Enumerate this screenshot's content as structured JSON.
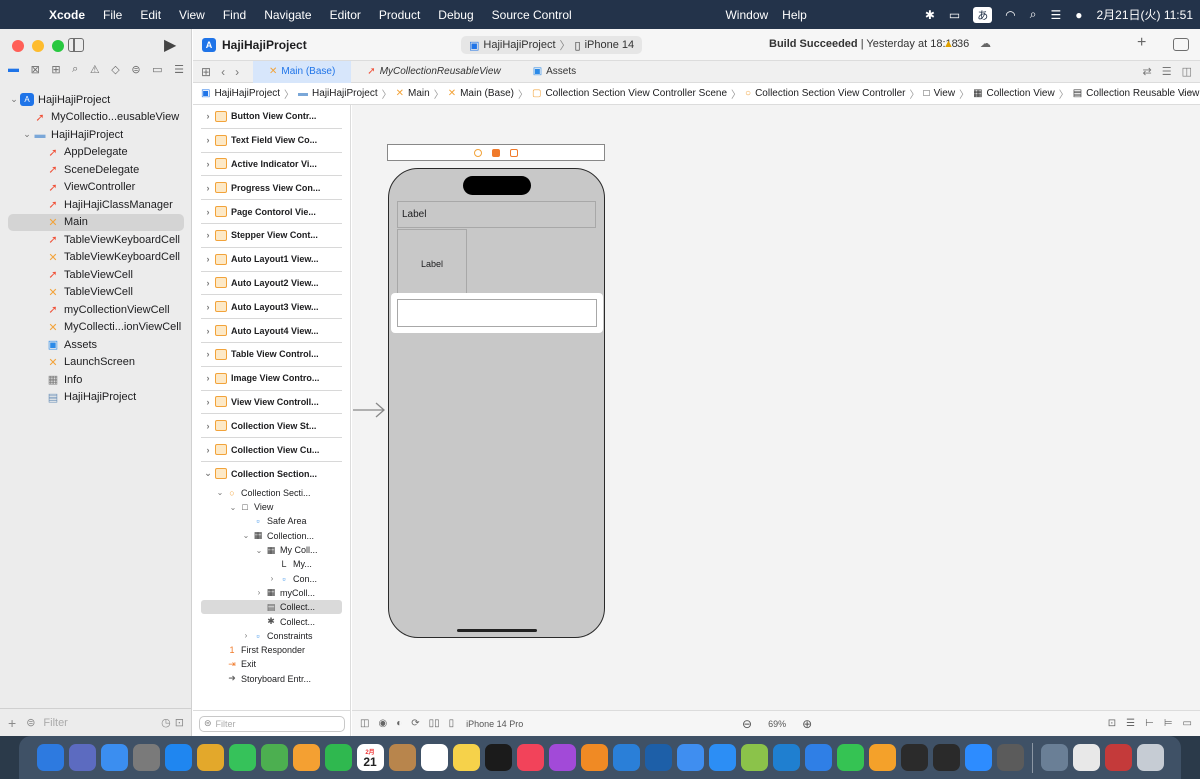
{
  "menubar": {
    "app": "Xcode",
    "items": [
      "File",
      "Edit",
      "View",
      "Find",
      "Navigate",
      "Editor",
      "Product",
      "Debug",
      "Source Control"
    ],
    "right_items": [
      "Window",
      "Help"
    ],
    "input_method": "あ",
    "clock": "2月21日(火)  11:51"
  },
  "navigator": {
    "tree": [
      {
        "label": "HajiHajiProject",
        "icon": "app-icon",
        "chev": "⌄",
        "indent": 0
      },
      {
        "label": "MyCollectio...eusableView",
        "icon": "swift-icon",
        "chev": "",
        "indent": 1
      },
      {
        "label": "HajiHajiProject",
        "icon": "folder-icon",
        "chev": "⌄",
        "indent": 1
      },
      {
        "label": "AppDelegate",
        "icon": "swift-icon",
        "chev": "",
        "indent": 2
      },
      {
        "label": "SceneDelegate",
        "icon": "swift-icon",
        "chev": "",
        "indent": 2
      },
      {
        "label": "ViewController",
        "icon": "swift-icon",
        "chev": "",
        "indent": 2
      },
      {
        "label": "HajiHajiClassManager",
        "icon": "swift-icon",
        "chev": "",
        "indent": 2
      },
      {
        "label": "Main",
        "icon": "storyboard-icon",
        "chev": "",
        "indent": 2,
        "selected": true
      },
      {
        "label": "TableViewKeyboardCell",
        "icon": "swift-icon",
        "chev": "",
        "indent": 2
      },
      {
        "label": "TableViewKeyboardCell",
        "icon": "xib-icon",
        "chev": "",
        "indent": 2
      },
      {
        "label": "TableViewCell",
        "icon": "swift-icon",
        "chev": "",
        "indent": 2
      },
      {
        "label": "TableViewCell",
        "icon": "xib-icon",
        "chev": "",
        "indent": 2
      },
      {
        "label": "myCollectionViewCell",
        "icon": "swift-icon",
        "chev": "",
        "indent": 2
      },
      {
        "label": "MyCollecti...ionViewCell",
        "icon": "xib-icon",
        "chev": "",
        "indent": 2
      },
      {
        "label": "Assets",
        "icon": "assets-icon",
        "chev": "",
        "indent": 2
      },
      {
        "label": "LaunchScreen",
        "icon": "xib-icon",
        "chev": "",
        "indent": 2
      },
      {
        "label": "Info",
        "icon": "plist-icon",
        "chev": "",
        "indent": 2
      },
      {
        "label": "HajiHajiProject",
        "icon": "entitlements-icon",
        "chev": "",
        "indent": 2
      }
    ],
    "filter_placeholder": "Filter"
  },
  "toolbar": {
    "project": "HajiHajiProject",
    "scheme": "HajiHajiProject",
    "destination": "iPhone 14",
    "status_bold": "Build Succeeded",
    "status_rest": " | Yesterday at 18:18",
    "warnings": "36"
  },
  "tabs": [
    {
      "label": "Main (Base)",
      "active": true
    },
    {
      "label": "MyCollectionReusableView",
      "italic": true
    },
    {
      "label": "Assets"
    }
  ],
  "jumpbar": [
    "HajiHajiProject",
    "HajiHajiProject",
    "Main",
    "Main (Base)",
    "Collection Section View Controller Scene",
    "Collection Section View Controller",
    "View",
    "Collection View",
    "Collection Reusable View"
  ],
  "outline": {
    "scenes": [
      "Button View Contr...",
      "Text Field View Co...",
      "Active Indicator Vi...",
      "Progress View Con...",
      "Page Contorol Vie...",
      "Stepper View Cont...",
      "Auto Layout1 View...",
      "Auto Layout2 View...",
      "Auto Layout3 View...",
      "Auto Layout4 View...",
      "Table View Control...",
      "Image View Contro...",
      "View View Controll...",
      "Collection View St...",
      "Collection View Cu..."
    ],
    "open_scene": "Collection Section...",
    "nodes": [
      {
        "label": "Collection Secti...",
        "indent": 1,
        "chev": "⌄",
        "icon": "○"
      },
      {
        "label": "View",
        "indent": 2,
        "chev": "⌄",
        "icon": "□"
      },
      {
        "label": "Safe Area",
        "indent": 3,
        "chev": "",
        "icon": "▫"
      },
      {
        "label": "Collection...",
        "indent": 3,
        "chev": "⌄",
        "icon": "▦"
      },
      {
        "label": "My Coll...",
        "indent": 4,
        "chev": "⌄",
        "icon": "▦"
      },
      {
        "label": "My...",
        "indent": 5,
        "chev": "",
        "icon": "L"
      },
      {
        "label": "Con...",
        "indent": 5,
        "chev": "›",
        "icon": "▫"
      },
      {
        "label": "myColl...",
        "indent": 4,
        "chev": "›",
        "icon": "▦"
      },
      {
        "label": "Collect...",
        "indent": 4,
        "chev": "",
        "icon": "▤",
        "selected": true
      },
      {
        "label": "Collect...",
        "indent": 4,
        "chev": "",
        "icon": "✱"
      },
      {
        "label": "Constraints",
        "indent": 3,
        "chev": "›",
        "icon": "▫"
      },
      {
        "label": "First Responder",
        "indent": 1,
        "chev": "",
        "icon": "1"
      },
      {
        "label": "Exit",
        "indent": 1,
        "chev": "",
        "icon": "⇥"
      },
      {
        "label": "Storyboard Entr...",
        "indent": 1,
        "chev": "",
        "icon": "➜"
      }
    ],
    "filter_placeholder": "Filter"
  },
  "canvas": {
    "label_top": "Label",
    "label_cell": "Label",
    "device": "iPhone 14 Pro",
    "zoom": "69%"
  },
  "dock": {
    "calendar_month": "2月",
    "calendar_day": "21",
    "apps": [
      {
        "name": "finder-icon",
        "color": "#2d7ae0"
      },
      {
        "name": "launchpad-icon",
        "color": "#5c6bc0"
      },
      {
        "name": "mail-icon",
        "color": "#3b8ef0"
      },
      {
        "name": "system-settings-icon",
        "color": "#7a7a7a"
      },
      {
        "name": "safari-icon",
        "color": "#1f86f0"
      },
      {
        "name": "chrome-icon",
        "color": "#e3a82b"
      },
      {
        "name": "messages-icon",
        "color": "#36c25a"
      },
      {
        "name": "maps-icon",
        "color": "#4caf50"
      },
      {
        "name": "photos-icon",
        "color": "#f4a032"
      },
      {
        "name": "facetime-icon",
        "color": "#2fb84f"
      },
      {
        "name": "calendar-icon",
        "color": "#ffffff"
      },
      {
        "name": "notes-brown-icon",
        "color": "#b8854c"
      },
      {
        "name": "reminders-icon",
        "color": "#ffffff"
      },
      {
        "name": "notes-icon",
        "color": "#f6d24a"
      },
      {
        "name": "tv-icon",
        "color": "#1b1b1b"
      },
      {
        "name": "music-icon",
        "color": "#f2435a"
      },
      {
        "name": "podcasts-icon",
        "color": "#a24ad8"
      },
      {
        "name": "books-icon",
        "color": "#f08a24"
      },
      {
        "name": "xcode-icon",
        "color": "#2a7fd8"
      },
      {
        "name": "instruments-icon",
        "color": "#1d5fa8"
      },
      {
        "name": "testflight-icon",
        "color": "#3f8ef0"
      },
      {
        "name": "appstore-icon",
        "color": "#2c8ef5"
      },
      {
        "name": "sketch-icon",
        "color": "#8bc34a"
      },
      {
        "name": "vscode-icon",
        "color": "#1f7fd0"
      },
      {
        "name": "keynote-icon",
        "color": "#2f7fe6"
      },
      {
        "name": "numbers-icon",
        "color": "#35c353"
      },
      {
        "name": "pages-icon",
        "color": "#f4a12a"
      },
      {
        "name": "github-icon",
        "color": "#2b2b2b"
      },
      {
        "name": "terminal-icon",
        "color": "#2a2a2a"
      },
      {
        "name": "zoom-icon",
        "color": "#2d8cff"
      },
      {
        "name": "calculator-icon",
        "color": "#5b5b5b"
      },
      {
        "name": "preview-icon",
        "color": "#6a7f96"
      },
      {
        "name": "textedit-icon",
        "color": "#e8e8e8"
      },
      {
        "name": "dictionary-icon",
        "color": "#c43a3a"
      },
      {
        "name": "trash-icon",
        "color": "#c6ccd4"
      }
    ]
  },
  "colors": {
    "accent": "#1f74e8",
    "swift": "#f05138",
    "storyboard": "#f2a33a",
    "warning": "#e0a100"
  }
}
